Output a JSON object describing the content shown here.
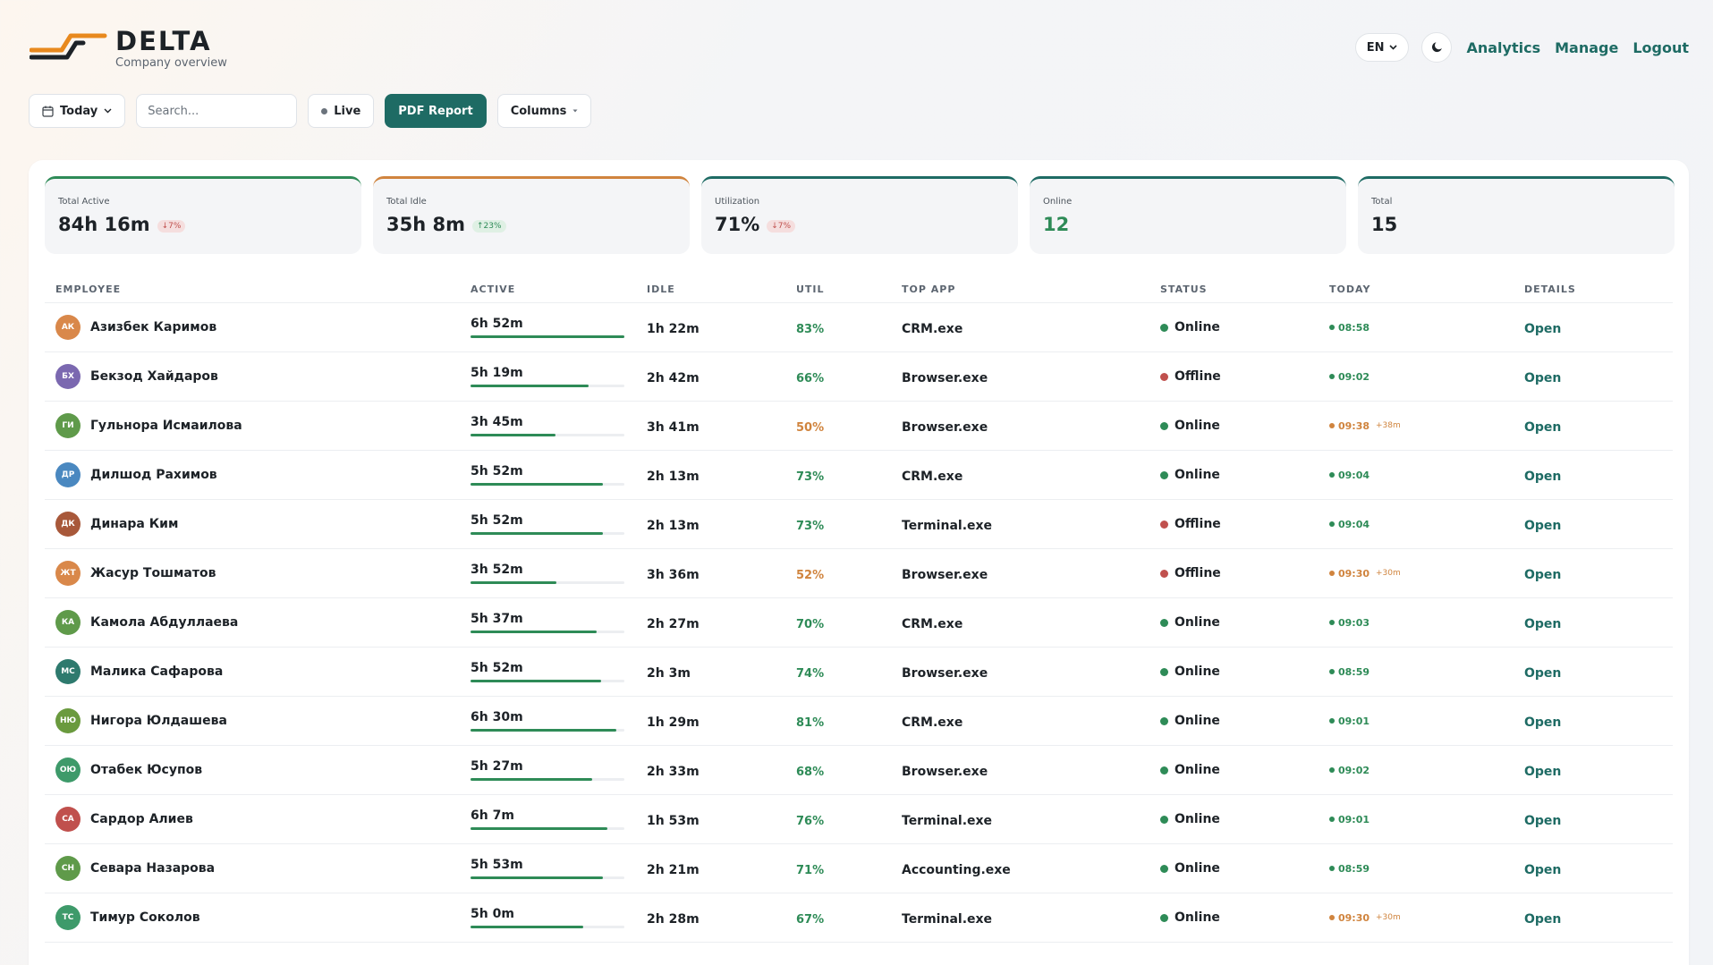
{
  "header": {
    "brand": "DELTA",
    "subtitle": "Company overview",
    "lang": "EN",
    "nav": [
      "Analytics",
      "Manage",
      "Logout"
    ]
  },
  "toolbar": {
    "date_label": "Today",
    "search_placeholder": "Search...",
    "live_label": "Live",
    "pdf_label": "PDF Report",
    "columns_label": "Columns"
  },
  "stats": [
    {
      "label": "Total Active",
      "value": "84h 16m",
      "badge": "↓7%",
      "trend": "down"
    },
    {
      "label": "Total Idle",
      "value": "35h 8m",
      "badge": "↑23%",
      "trend": "up"
    },
    {
      "label": "Utilization",
      "value": "71%",
      "badge": "↓7%",
      "trend": "down"
    },
    {
      "label": "Online",
      "value": "12",
      "badge": "",
      "trend": ""
    },
    {
      "label": "Total",
      "value": "15",
      "badge": "",
      "trend": ""
    }
  ],
  "columns": [
    "EMPLOYEE",
    "ACTIVE",
    "IDLE",
    "UTIL",
    "TOP APP",
    "STATUS",
    "TODAY",
    "DETAILS"
  ],
  "details_label": "Open",
  "colors": {
    "accent": "#1e6b64",
    "good": "#2e8b57",
    "warn": "#d0843e",
    "bad": "#c0504d"
  },
  "rows": [
    {
      "initials": "АК",
      "avatar_color": "#d9884a",
      "name": "Азизбек Каримов",
      "active": "6h 52m",
      "active_pct": 100,
      "idle": "1h 22m",
      "util": "83%",
      "util_level": "good",
      "app": "CRM.exe",
      "status": "Online",
      "online": true,
      "today": "08:58",
      "late": false,
      "delta": ""
    },
    {
      "initials": "БХ",
      "avatar_color": "#7b68b0",
      "name": "Бекзод Хайдаров",
      "active": "5h 19m",
      "active_pct": 77,
      "idle": "2h 42m",
      "util": "66%",
      "util_level": "good",
      "app": "Browser.exe",
      "status": "Offline",
      "online": false,
      "today": "09:02",
      "late": false,
      "delta": ""
    },
    {
      "initials": "ГИ",
      "avatar_color": "#5f9a4a",
      "name": "Гульнора Исмаилова",
      "active": "3h 45m",
      "active_pct": 55,
      "idle": "3h 41m",
      "util": "50%",
      "util_level": "warn",
      "app": "Browser.exe",
      "status": "Online",
      "online": true,
      "today": "09:38",
      "late": true,
      "delta": "+38m"
    },
    {
      "initials": "ДР",
      "avatar_color": "#4a88c0",
      "name": "Дилшод Рахимов",
      "active": "5h 52m",
      "active_pct": 86,
      "idle": "2h 13m",
      "util": "73%",
      "util_level": "good",
      "app": "CRM.exe",
      "status": "Online",
      "online": true,
      "today": "09:04",
      "late": false,
      "delta": ""
    },
    {
      "initials": "ДК",
      "avatar_color": "#a8583a",
      "name": "Динара Ким",
      "active": "5h 52m",
      "active_pct": 86,
      "idle": "2h 13m",
      "util": "73%",
      "util_level": "good",
      "app": "Terminal.exe",
      "status": "Offline",
      "online": false,
      "today": "09:04",
      "late": false,
      "delta": ""
    },
    {
      "initials": "ЖТ",
      "avatar_color": "#d9884a",
      "name": "Жасур Тошматов",
      "active": "3h 52m",
      "active_pct": 56,
      "idle": "3h 36m",
      "util": "52%",
      "util_level": "warn",
      "app": "Browser.exe",
      "status": "Offline",
      "online": false,
      "today": "09:30",
      "late": true,
      "delta": "+30m"
    },
    {
      "initials": "КА",
      "avatar_color": "#5f9a4a",
      "name": "Камола Абдуллаева",
      "active": "5h 37m",
      "active_pct": 82,
      "idle": "2h 27m",
      "util": "70%",
      "util_level": "good",
      "app": "CRM.exe",
      "status": "Online",
      "online": true,
      "today": "09:03",
      "late": false,
      "delta": ""
    },
    {
      "initials": "МС",
      "avatar_color": "#2e7a6e",
      "name": "Малика Сафарова",
      "active": "5h 52m",
      "active_pct": 85,
      "idle": "2h 3m",
      "util": "74%",
      "util_level": "good",
      "app": "Browser.exe",
      "status": "Online",
      "online": true,
      "today": "08:59",
      "late": false,
      "delta": ""
    },
    {
      "initials": "НЮ",
      "avatar_color": "#6a9a3e",
      "name": "Нигора Юлдашева",
      "active": "6h 30m",
      "active_pct": 95,
      "idle": "1h 29m",
      "util": "81%",
      "util_level": "good",
      "app": "CRM.exe",
      "status": "Online",
      "online": true,
      "today": "09:01",
      "late": false,
      "delta": ""
    },
    {
      "initials": "ОЮ",
      "avatar_color": "#3e9a6a",
      "name": "Отабек Юсупов",
      "active": "5h 27m",
      "active_pct": 79,
      "idle": "2h 33m",
      "util": "68%",
      "util_level": "good",
      "app": "Browser.exe",
      "status": "Online",
      "online": true,
      "today": "09:02",
      "late": false,
      "delta": ""
    },
    {
      "initials": "СА",
      "avatar_color": "#c0504d",
      "name": "Сардор Алиев",
      "active": "6h 7m",
      "active_pct": 89,
      "idle": "1h 53m",
      "util": "76%",
      "util_level": "good",
      "app": "Terminal.exe",
      "status": "Online",
      "online": true,
      "today": "09:01",
      "late": false,
      "delta": ""
    },
    {
      "initials": "СН",
      "avatar_color": "#5f9a4a",
      "name": "Севара Назарова",
      "active": "5h 53m",
      "active_pct": 86,
      "idle": "2h 21m",
      "util": "71%",
      "util_level": "good",
      "app": "Accounting.exe",
      "status": "Online",
      "online": true,
      "today": "08:59",
      "late": false,
      "delta": ""
    },
    {
      "initials": "ТС",
      "avatar_color": "#3e9a6a",
      "name": "Тимур Соколов",
      "active": "5h 0m",
      "active_pct": 73,
      "idle": "2h 28m",
      "util": "67%",
      "util_level": "good",
      "app": "Terminal.exe",
      "status": "Online",
      "online": true,
      "today": "09:30",
      "late": true,
      "delta": "+30m"
    }
  ]
}
